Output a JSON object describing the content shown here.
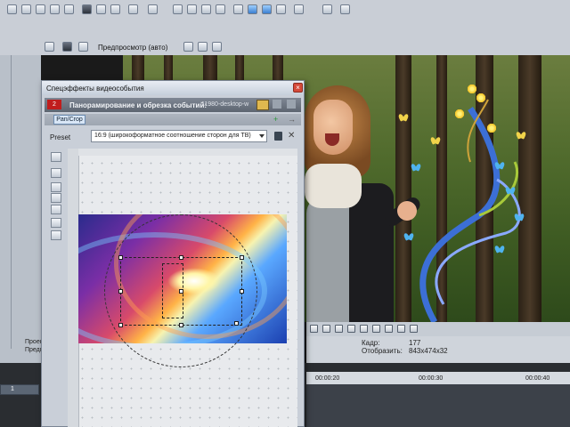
{
  "main_toolbar": {
    "preview_mode_label": "Предпросмотр (авто)"
  },
  "left_panel": {
    "label_1": "Проек",
    "label_2": "Предп"
  },
  "info_panel": {
    "frame_label": "Кадр:",
    "frame_value": "177",
    "display_label": "Отобразить:",
    "display_value": "843x474x32"
  },
  "timeline": {
    "track_number": "1",
    "ruler_marks": [
      "00:00:20",
      "00:00:30",
      "00:00:40"
    ]
  },
  "fx_dialog": {
    "title": "Спецэффекты видеособытия",
    "close_label": "×",
    "chain_number": "2",
    "chain_title": "Панорамирование и обрезка событий:",
    "chain_file": "11980-desktop-w",
    "plugin_chip": "Pan/Crop",
    "plugin_add": "+",
    "plugin_remove": "→",
    "preset_label": "Preset",
    "preset_value": "16:9 (широкоформатное соотношение сторон для ТВ)",
    "preset_delete": "✕"
  },
  "colors": {
    "chain_number_bg": "#c01d1d",
    "toolbar_bg": "#c9ced6",
    "dialog_bg": "#c9cfd8"
  }
}
